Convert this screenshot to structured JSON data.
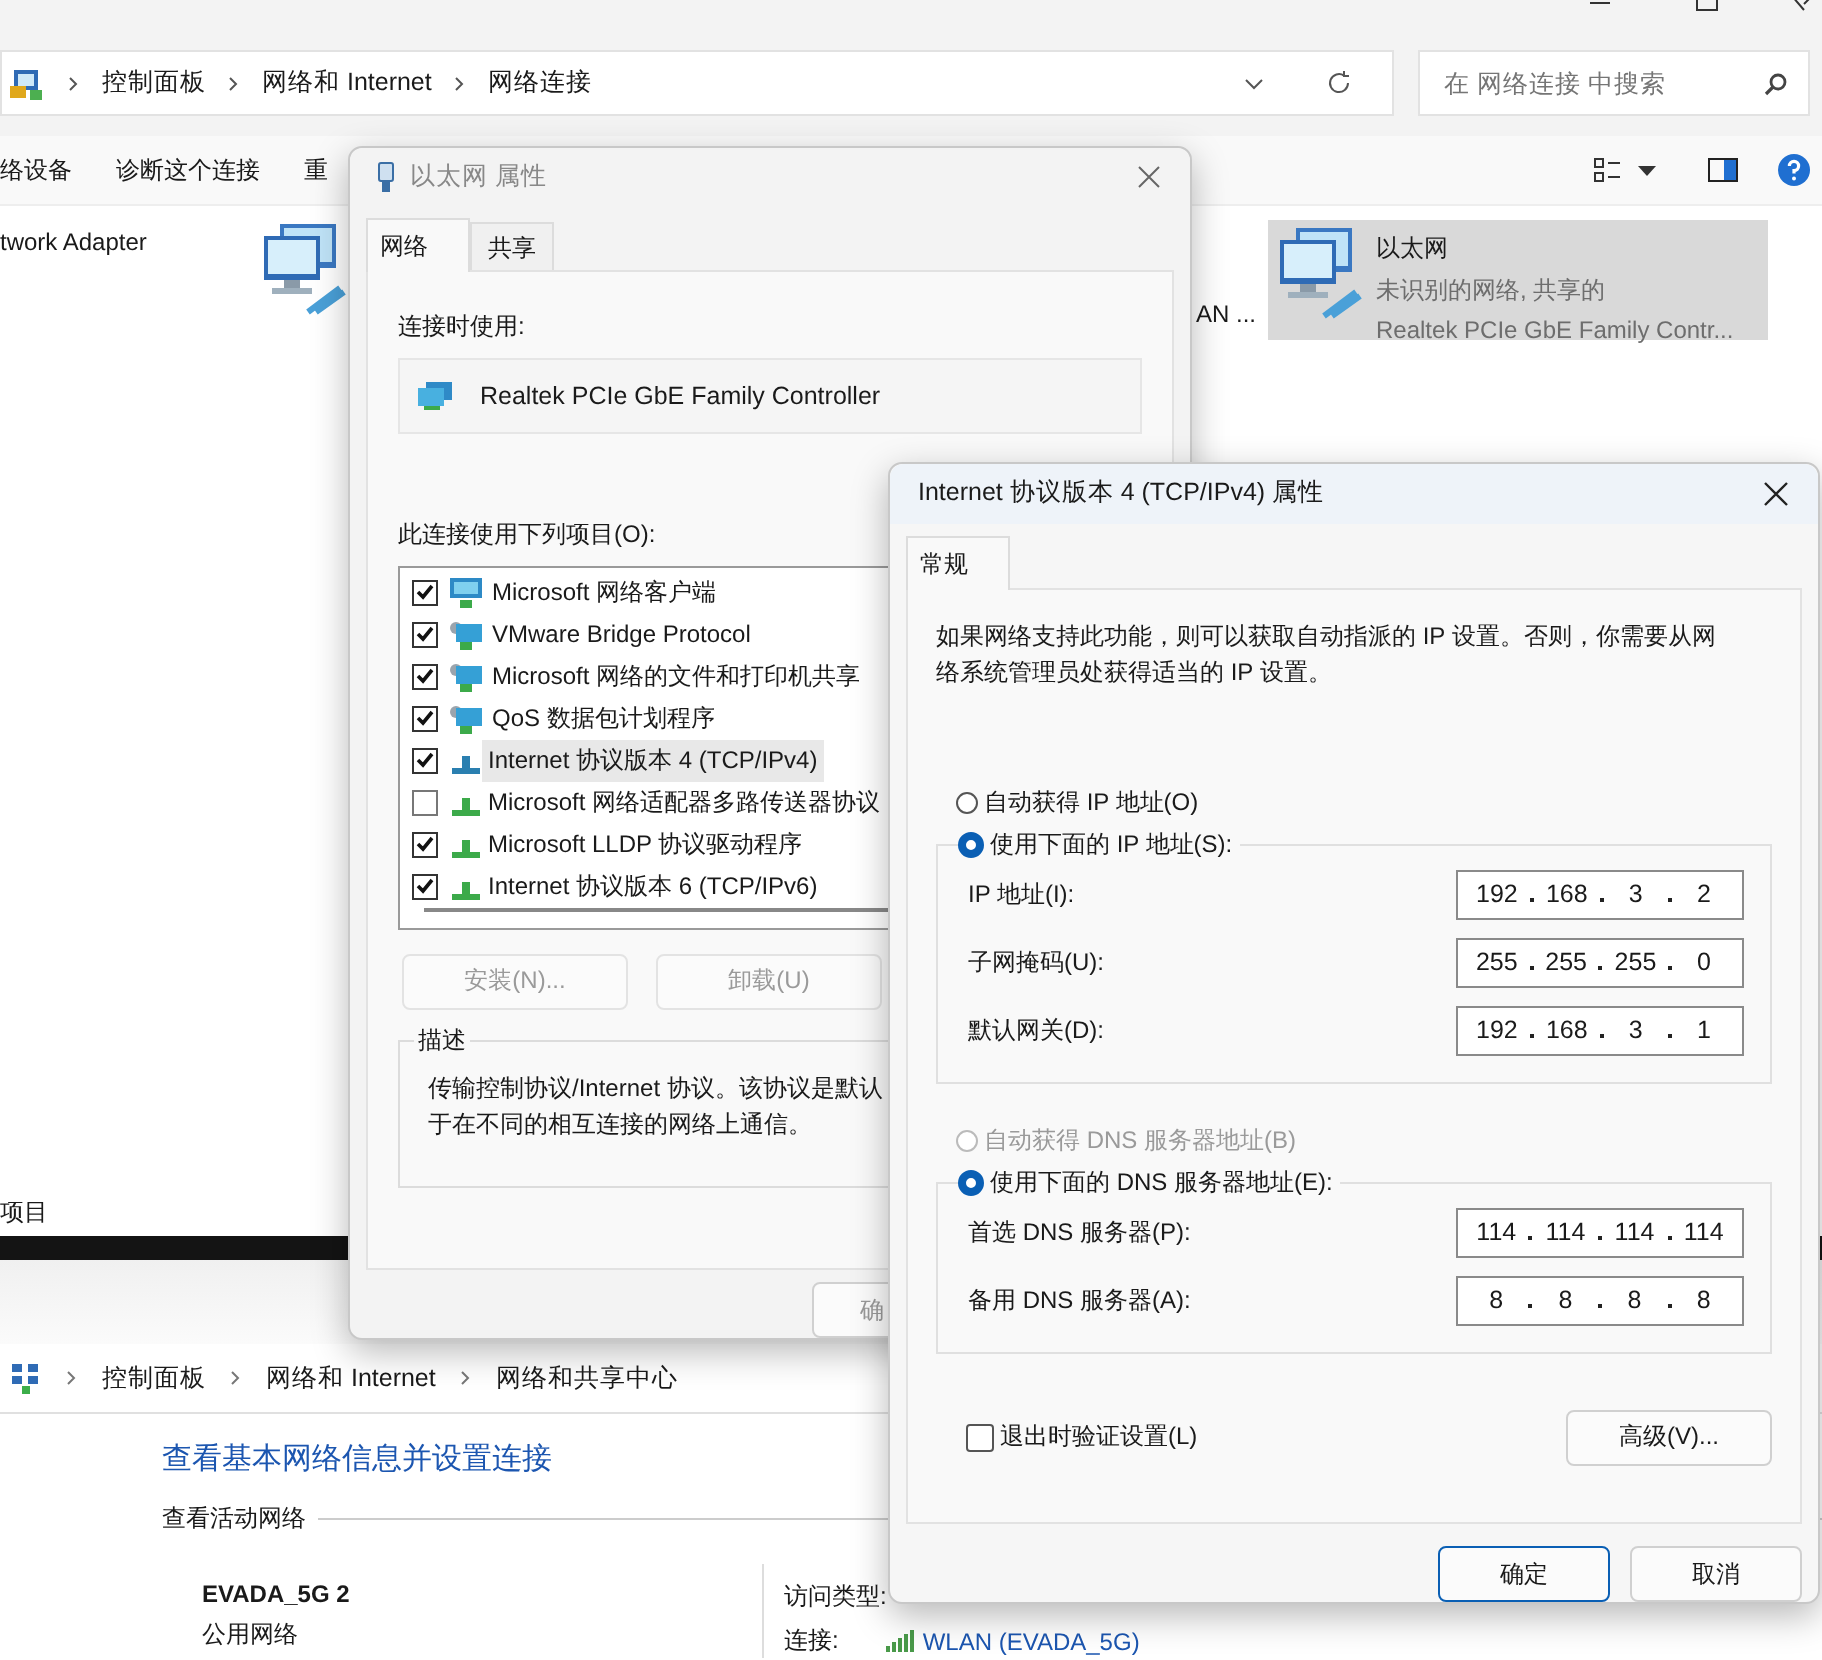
{
  "explorer": {
    "breadcrumb": [
      "控制面板",
      "网络和 Internet",
      "网络连接"
    ],
    "search": {
      "placeholder": "在 网络连接 中搜索"
    },
    "toolbar": [
      "络设备",
      "诊断这个连接",
      "重"
    ],
    "adapters": [
      {
        "name": "twork Adapter",
        "kind": "label",
        "selected": false
      },
      {
        "kind": "icon",
        "selected": false
      },
      {
        "name": "AN ...",
        "kind": "label",
        "selected": false
      },
      {
        "name": "以太网",
        "status": "未识别的网络, 共享的",
        "device": "Realtek PCIe GbE Family Contr...",
        "kind": "tile",
        "selected": true
      }
    ],
    "status_text": "项目"
  },
  "network_center": {
    "breadcrumb": [
      "控制面板",
      "网络和 Internet",
      "网络和共享中心"
    ],
    "heading": "查看基本网络信息并设置连接",
    "section": "查看活动网络",
    "network_name": "EVADA_5G 2",
    "network_type": "公用网络",
    "access_label": "访问类型:",
    "connection_label": "连接:",
    "connection_value": "WLAN (EVADA_5G)"
  },
  "ethernet_dialog": {
    "title": "以太网 属性",
    "tabs": [
      {
        "label": "网络",
        "selected": true
      },
      {
        "label": "共享",
        "selected": false
      }
    ],
    "connect_using_label": "连接时使用:",
    "adapter": "Realtek PCIe GbE Family Controller",
    "items_label": "此连接使用下列项目(O):",
    "items": [
      {
        "label": "Microsoft 网络客户端",
        "checked": true,
        "selected": false,
        "kind": "client"
      },
      {
        "label": "VMware Bridge Protocol",
        "checked": true,
        "selected": false,
        "kind": "service"
      },
      {
        "label": "Microsoft 网络的文件和打印机共享",
        "checked": true,
        "selected": false,
        "kind": "service"
      },
      {
        "label": "QoS 数据包计划程序",
        "checked": true,
        "selected": false,
        "kind": "service"
      },
      {
        "label": "Internet 协议版本 4 (TCP/IPv4)",
        "checked": true,
        "selected": true,
        "kind": "protocol"
      },
      {
        "label": "Microsoft 网络适配器多路传送器协议",
        "checked": false,
        "selected": false,
        "kind": "protocol"
      },
      {
        "label": "Microsoft LLDP 协议驱动程序",
        "checked": true,
        "selected": false,
        "kind": "protocol"
      },
      {
        "label": "Internet 协议版本 6 (TCP/IPv6)",
        "checked": true,
        "selected": false,
        "kind": "protocol"
      }
    ],
    "buttons": [
      {
        "label": "安装(N)...",
        "disabled": true
      },
      {
        "label": "卸载(U)",
        "disabled": true
      }
    ],
    "description_label": "描述",
    "description": [
      "传输控制协议/Internet 协议。该协议是默认",
      "于在不同的相互连接的网络上通信。"
    ],
    "ok_button": "确"
  },
  "ipv4_dialog": {
    "title": "Internet 协议版本 4 (TCP/IPv4) 属性",
    "tabs": [
      {
        "label": "常规",
        "selected": true
      }
    ],
    "intro": "如果网络支持此功能，则可以获取自动指派的 IP 设置。否则，你需要从网络系统管理员处获得适当的 IP 设置。",
    "ip_mode": [
      {
        "label": "自动获得 IP 地址(O)",
        "selected": false,
        "disabled": false
      },
      {
        "label": "使用下面的 IP 地址(S):",
        "selected": true,
        "disabled": false
      }
    ],
    "ip_fields": [
      {
        "label": "IP 地址(I):",
        "octets": [
          "192",
          "168",
          "3",
          "2"
        ]
      },
      {
        "label": "子网掩码(U):",
        "octets": [
          "255",
          "255",
          "255",
          "0"
        ]
      },
      {
        "label": "默认网关(D):",
        "octets": [
          "192",
          "168",
          "3",
          "1"
        ]
      }
    ],
    "dns_mode": [
      {
        "label": "自动获得 DNS 服务器地址(B)",
        "selected": false,
        "disabled": true
      },
      {
        "label": "使用下面的 DNS 服务器地址(E):",
        "selected": true,
        "disabled": false
      }
    ],
    "dns_fields": [
      {
        "label": "首选 DNS 服务器(P):",
        "octets": [
          "114",
          "114",
          "114",
          "114"
        ]
      },
      {
        "label": "备用 DNS 服务器(A):",
        "octets": [
          "8",
          "8",
          "8",
          "8"
        ]
      }
    ],
    "validate": {
      "label": "退出时验证设置(L)",
      "checked": false
    },
    "advanced_button": "高级(V)...",
    "buttons": [
      {
        "label": "确定",
        "default": true
      },
      {
        "label": "取消",
        "default": false
      }
    ]
  }
}
